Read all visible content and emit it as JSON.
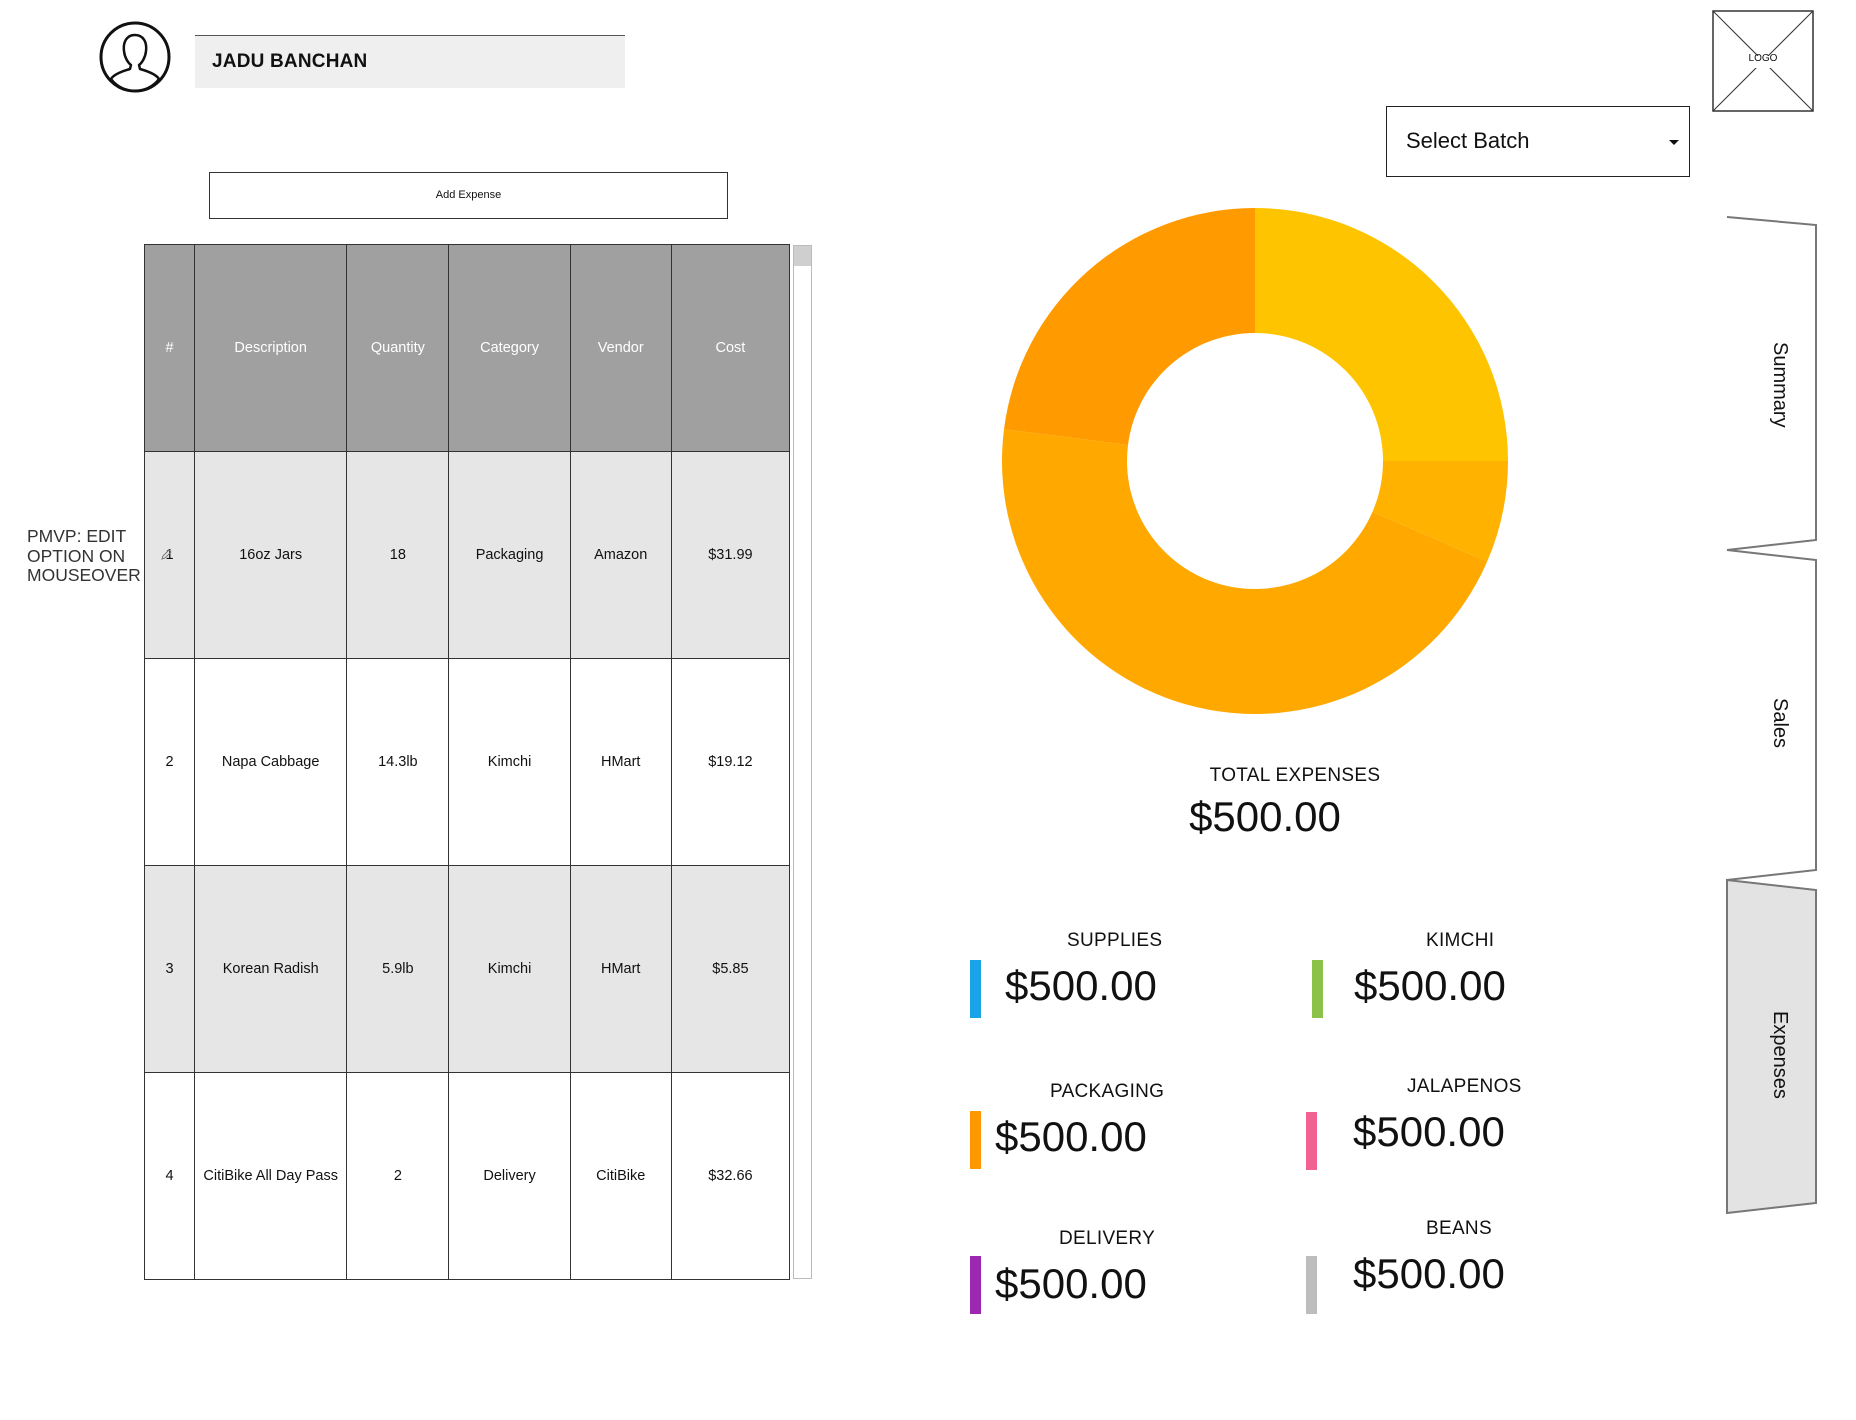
{
  "header": {
    "user_name": "JADU BANCHAN",
    "logo_text": "LOGO",
    "batch_select": {
      "value": "Select Batch",
      "icon": "chevron-down-icon"
    }
  },
  "toolbar": {
    "add_expense_label": "Add  Expense"
  },
  "note": "PMVP: EDIT OPTION ON MOUSEOVER",
  "table": {
    "columns": [
      "#",
      "Description",
      "Quantity",
      "Category",
      "Vendor",
      "Cost"
    ],
    "rows": [
      {
        "num": "1",
        "description": "16oz Jars",
        "quantity": "18",
        "category": "Packaging",
        "vendor": "Amazon",
        "cost": "$31.99"
      },
      {
        "num": "2",
        "description": "Napa Cabbage",
        "quantity": "14.3lb",
        "category": "Kimchi",
        "vendor": "HMart",
        "cost": "$19.12"
      },
      {
        "num": "3",
        "description": "Korean Radish",
        "quantity": "5.9lb",
        "category": "Kimchi",
        "vendor": "HMart",
        "cost": "$5.85"
      },
      {
        "num": "4",
        "description": "CitiBike All Day Pass",
        "quantity": "2",
        "category": "Delivery",
        "vendor": "CitiBike",
        "cost": "$32.66"
      }
    ]
  },
  "chart_data": {
    "type": "pie",
    "donut": true,
    "slices": [
      {
        "value": 25.0,
        "color": "#ffc400"
      },
      {
        "value": 23.0,
        "color": "#ff9b00"
      },
      {
        "value": 45.5,
        "color": "#ffa800"
      },
      {
        "value": 6.5,
        "color": "#ffb300"
      }
    ]
  },
  "totals": {
    "label": "TOTAL EXPENSES",
    "value": "$500.00"
  },
  "categories": [
    {
      "label": "SUPPLIES",
      "value": "$500.00",
      "color": "#1aa3e8"
    },
    {
      "label": "KIMCHI",
      "value": "$500.00",
      "color": "#8bc34a"
    },
    {
      "label": "PACKAGING",
      "value": "$500.00",
      "color": "#ff9800"
    },
    {
      "label": "JALAPENOS",
      "value": "$500.00",
      "color": "#f06292"
    },
    {
      "label": "DELIVERY",
      "value": "$500.00",
      "color": "#9c27b0"
    },
    {
      "label": "BEANS",
      "value": "$500.00",
      "color": "#bdbdbd"
    }
  ],
  "tabs": [
    {
      "label": "Summary",
      "active": false
    },
    {
      "label": "Sales",
      "active": false
    },
    {
      "label": "Expenses",
      "active": true
    }
  ]
}
